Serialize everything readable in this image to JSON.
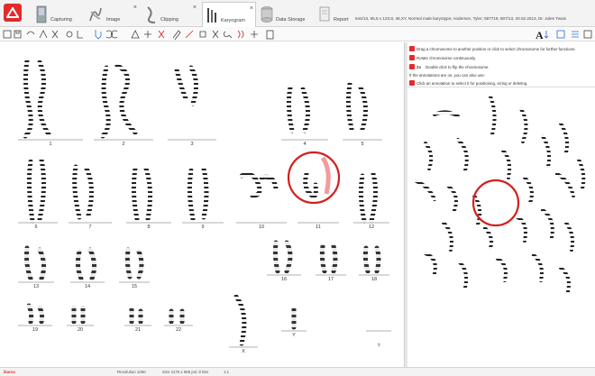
{
  "tabs": [
    {
      "label": "Capturing",
      "icon": "capturing-icon",
      "closable": false
    },
    {
      "label": "Image",
      "icon": "image-icon",
      "closable": true
    },
    {
      "label": "Clipping",
      "icon": "clipping-icon",
      "closable": true
    },
    {
      "label": "Karyogram",
      "icon": "karyogram-icon",
      "closable": true
    },
    {
      "label": "Data Storage",
      "icon": "data-storage-icon",
      "closable": false
    },
    {
      "label": "Report",
      "icon": "report-icon",
      "closable": false
    }
  ],
  "active_tab": "Karyogram",
  "case_info": "544/13, 65,5 x 123,8, 46,XY, Normal male karyotype; Anderson, Tyler; 587719, 807/13, 20.02.2013, Dr. Jules Twain",
  "help": {
    "line1": "Drag a chromosome to another position or click to select chromosome for further functions.",
    "line2": "Rotate chromosome continuously.",
    "line3_prefix": "2x",
    "line3": "Double click to flip the chromosome.",
    "line4": "If the annotations are on, you can also use:",
    "line5": "Click an annotation to select it for positioning, sizing or deleting."
  },
  "chromosome_labels": [
    "1",
    "2",
    "3",
    "4",
    "5",
    "6",
    "7",
    "8",
    "9",
    "10",
    "11",
    "12",
    "13",
    "14",
    "15",
    "16",
    "17",
    "18",
    "19",
    "20",
    "21",
    "22",
    "X",
    "Y",
    "?"
  ],
  "status": {
    "logo": "ikaros",
    "resolution": "Resolution 1050",
    "size": "Size 1170 x 965 pxl, 8 bits",
    "zoom": "1:1"
  },
  "colors": {
    "accent": "#e52a2a",
    "highlight_circle": "#d32020"
  }
}
